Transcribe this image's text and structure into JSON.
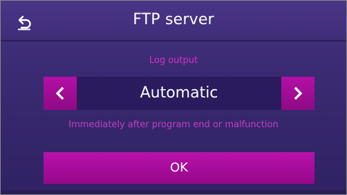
{
  "header": {
    "title": "FTP server",
    "back_icon": "back-arrow-icon"
  },
  "parameter": {
    "label": "Log output",
    "value": "Automatic",
    "prev_icon": "chevron-left-icon",
    "next_icon": "chevron-right-icon"
  },
  "hint": "Immediately after program end or malfunction",
  "ok_label": "OK",
  "colors": {
    "background": "#3a2a72",
    "accent": "#b40fa6",
    "label_text": "#d62fc4",
    "selector_bg": "#2a1b5e"
  }
}
